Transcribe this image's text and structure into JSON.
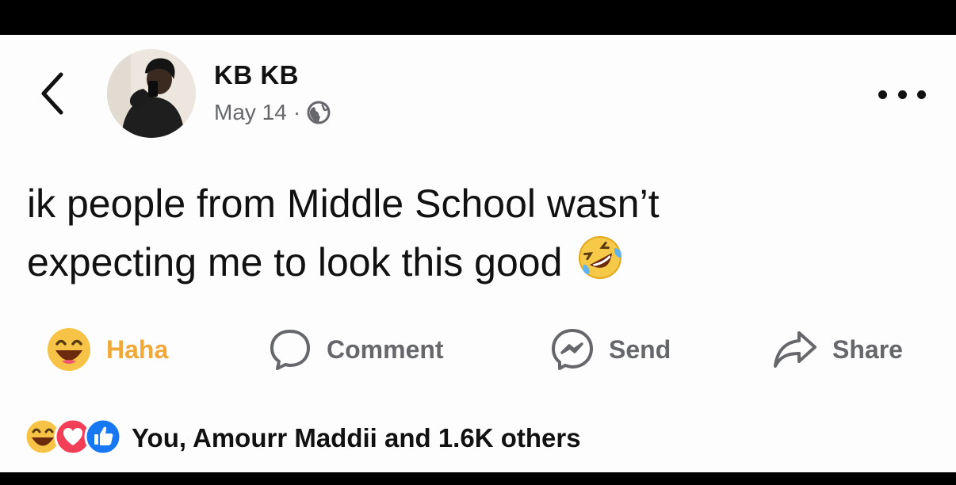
{
  "post": {
    "author": "KB KB",
    "date": "May 14",
    "separator": "·",
    "privacy_icon": "globe-icon",
    "text_line1": "ik people from Middle School wasn’t",
    "text_line2": "expecting me to look this good",
    "text_emoji": "rolling-on-floor-laughing-emoji"
  },
  "actions": {
    "haha_label": "Haha",
    "comment_label": "Comment",
    "send_label": "Send",
    "share_label": "Share"
  },
  "reactions": {
    "icons": [
      "haha-icon",
      "love-icon",
      "like-icon"
    ],
    "summary": "You, Amourr Maddii and 1.6K others"
  },
  "colors": {
    "haha_accent": "#f0a838",
    "muted_text": "#65676b",
    "like_blue": "#1877f2",
    "love_red": "#f33e58"
  }
}
